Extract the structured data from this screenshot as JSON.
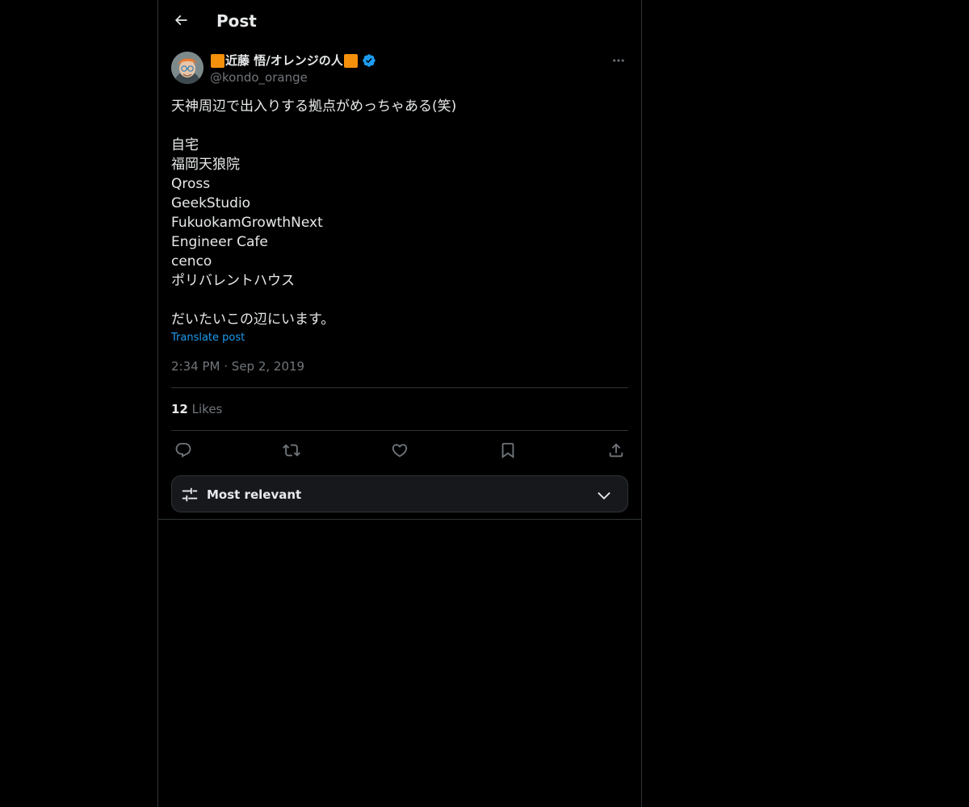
{
  "header": {
    "title": "Post",
    "back_icon": "arrow-left-icon"
  },
  "author": {
    "display_name": "近藤 悟/オレンジの人",
    "handle": "@kondo_orange",
    "verified": true,
    "badge_color": "#1d9bf0",
    "emoji_color": "#f4900c"
  },
  "post": {
    "text": "天神周辺で出入りする拠点がめっちゃある(笑)\n\n自宅\n福岡天狼院\nQross\nGeekStudio\nFukuokamGrowthNext\nEngineer Cafe\ncenco\nポリバレントハウス\n\nだいたいこの辺にいます。",
    "translate_label": "Translate post",
    "time": "2:34 PM",
    "separator": "·",
    "date": "Sep 2, 2019"
  },
  "stats": {
    "likes_count": "12",
    "likes_label": "Likes"
  },
  "actions": [
    {
      "name": "reply",
      "icon": "reply-icon"
    },
    {
      "name": "repost",
      "icon": "repost-icon"
    },
    {
      "name": "like",
      "icon": "heart-icon"
    },
    {
      "name": "bookmark",
      "icon": "bookmark-icon"
    },
    {
      "name": "share",
      "icon": "share-icon"
    }
  ],
  "sort": {
    "label": "Most relevant",
    "icon": "sliders-icon"
  },
  "colors": {
    "background": "#000000",
    "text_primary": "#e7e9ea",
    "text_secondary": "#71767b",
    "accent": "#1d9bf0",
    "border": "#2f3336"
  }
}
